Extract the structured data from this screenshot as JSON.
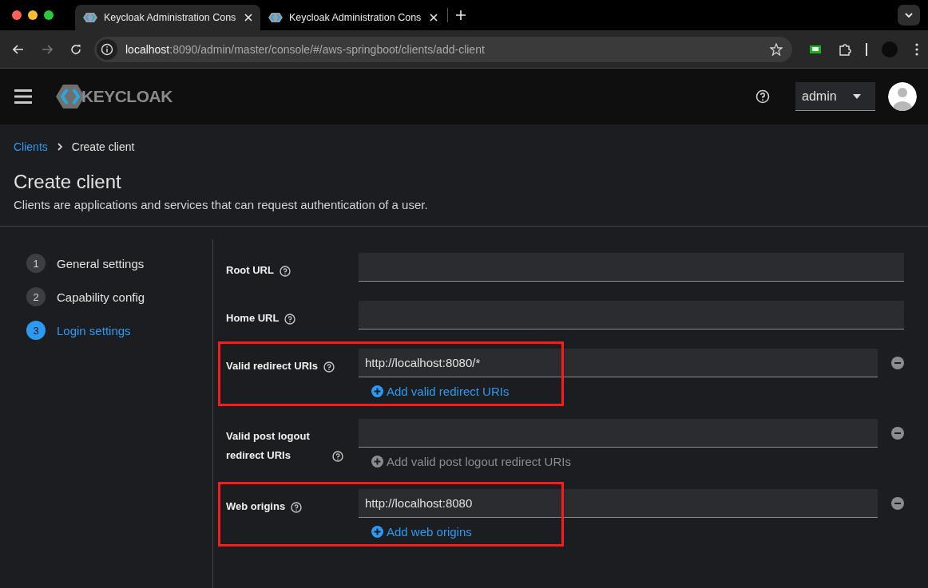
{
  "browser": {
    "tabs": [
      {
        "title": "Keycloak Administration Cons",
        "selected": true
      },
      {
        "title": "Keycloak Administration Cons",
        "selected": false
      }
    ],
    "address": {
      "host": "localhost",
      "path": ":8090/admin/master/console/#/aws-springboot/clients/add-client"
    }
  },
  "header": {
    "logo": "KEYCLOAK",
    "user": "admin"
  },
  "breadcrumb": [
    {
      "label": "Clients",
      "link": true
    },
    {
      "label": "Create client",
      "link": false
    }
  ],
  "page": {
    "title": "Create client",
    "subtitle": "Clients are applications and services that can request authentication of a user."
  },
  "steps": [
    {
      "number": "1",
      "label": "General settings",
      "selected": false
    },
    {
      "number": "2",
      "label": "Capability config",
      "selected": false
    },
    {
      "number": "3",
      "label": "Login settings",
      "selected": true
    }
  ],
  "fields": [
    {
      "label": "Root URL",
      "highlighted": false
    },
    {
      "label": "Home URL",
      "highlighted": false
    },
    {
      "label": "Valid redirect URIs",
      "value": "http://localhost:8080/*",
      "add_link": "Add valid redirect URIs",
      "add_disabled": false,
      "highlighted": true
    },
    {
      "label": "Valid post logout redirect URIs",
      "add_link": "Add valid post logout redirect URIs",
      "add_disabled": true,
      "highlighted": false
    },
    {
      "label": "Web origins",
      "value": "http://localhost:8080",
      "add_link": "Add web origins",
      "add_disabled": false,
      "highlighted": true
    }
  ]
}
